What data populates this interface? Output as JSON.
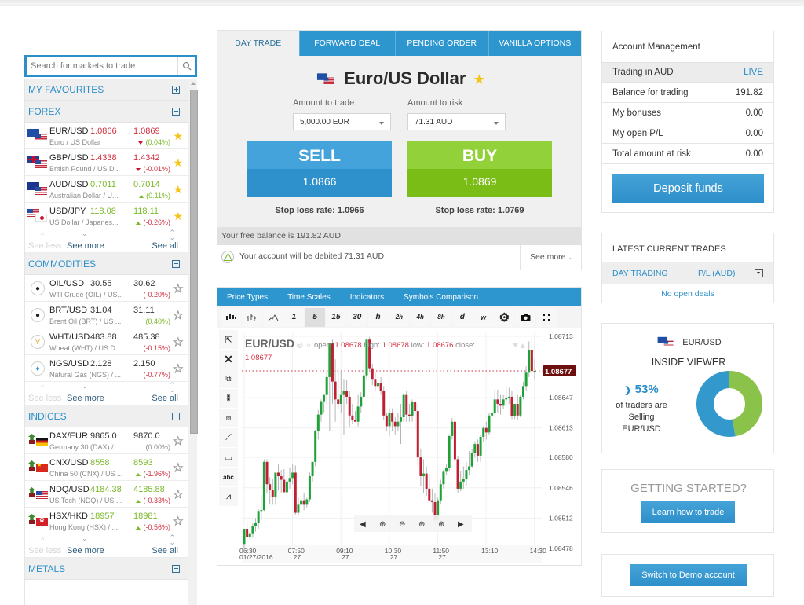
{
  "sidebar": {
    "search_placeholder": "Search for markets to trade",
    "categories": {
      "favourites": "MY FAVOURITES",
      "forex": "FOREX",
      "commodities": "COMMODITIES",
      "indices": "INDICES",
      "metals": "METALS"
    },
    "forex": [
      {
        "symbol": "EUR/USD",
        "bid": "1.0866",
        "ask": "1.0869",
        "desc": "Euro / US Dollar",
        "change": "(0.04%)",
        "dir": "down",
        "favourite": true
      },
      {
        "symbol": "GBP/USD",
        "bid": "1.4338",
        "ask": "1.4342",
        "desc": "British Pound / US D...",
        "change": "(-0.01%)",
        "dir": "down",
        "favourite": true
      },
      {
        "symbol": "AUD/USD",
        "bid": "0.7011",
        "ask": "0.7014",
        "desc": "Australian Dollar / U...",
        "change": "(0.11%)",
        "dir": "up",
        "favourite": true
      },
      {
        "symbol": "USD/JPY",
        "bid": "118.08",
        "ask": "118.11",
        "desc": "US Dollar / Japanes...",
        "change": "(-0.26%)",
        "dir": "up",
        "favourite": true
      }
    ],
    "commodities": [
      {
        "symbol": "OIL/USD",
        "bid": "30.55",
        "ask": "30.62",
        "desc": "WTI Crude (OIL) / US...",
        "change": "(-0.20%)",
        "dir": "none",
        "favourite": false
      },
      {
        "symbol": "BRT/USD",
        "bid": "31.04",
        "ask": "31.11",
        "desc": "Brent Oil (BRT) / US ...",
        "change": "(0.40%)",
        "dir": "none",
        "favourite": false
      },
      {
        "symbol": "WHT/USD",
        "bid": "483.88",
        "ask": "485.38",
        "desc": "Wheat (WHT) / US D...",
        "change": "(-0.15%)",
        "dir": "none",
        "favourite": false
      },
      {
        "symbol": "NGS/USD",
        "bid": "2.128",
        "ask": "2.150",
        "desc": "Natural Gas (NGS) / ...",
        "change": "(-0.77%)",
        "dir": "none",
        "favourite": false
      }
    ],
    "indices": [
      {
        "symbol": "DAX/EUR",
        "bid": "9865.0",
        "ask": "9870.0",
        "desc": "Germany 30 (DAX) / ...",
        "change": "(0.00%)",
        "dir": "none",
        "favourite": false
      },
      {
        "symbol": "CNX/USD",
        "bid": "8558",
        "ask": "8593",
        "desc": "China 50 (CNX) / US ...",
        "change": "(-1.96%)",
        "dir": "up",
        "favourite": false
      },
      {
        "symbol": "NDQ/USD",
        "bid": "4184.38",
        "ask": "4185.88",
        "desc": "US Tech (NDQ) / US ...",
        "change": "(-0.33%)",
        "dir": "up",
        "favourite": false
      },
      {
        "symbol": "HSX/HKD",
        "bid": "18957",
        "ask": "18981",
        "desc": "Hong Kong (HSX) / ...",
        "change": "(-0.56%)",
        "dir": "up",
        "favourite": false
      }
    ],
    "see_less": "See less",
    "see_more": "See more",
    "see_all": "See all",
    "colors": {
      "accent": "#2c8fc9",
      "red": "#d0303f",
      "green": "#7ab929",
      "star": "#f5c316"
    }
  },
  "trade": {
    "tabs": [
      "DAY TRADE",
      "FORWARD DEAL",
      "PENDING ORDER",
      "VANILLA OPTIONS"
    ],
    "active_tab": "DAY TRADE",
    "instrument": "Euro/US Dollar",
    "amount_trade_label": "Amount to trade",
    "amount_trade_value": "5,000.00 EUR",
    "amount_risk_label": "Amount to risk",
    "amount_risk_value": "71.31 AUD",
    "sell_label": "SELL",
    "sell_price": "1.0866",
    "buy_label": "BUY",
    "buy_price": "1.0869",
    "sell_stop_loss": "Stop loss rate: 1.0966",
    "buy_stop_loss": "Stop loss rate: 1.0769",
    "free_balance": "Your free balance is 191.82 AUD",
    "debit_notice": "Your account will be debited 71.31 AUD",
    "see_more": "See more"
  },
  "chart": {
    "menu": [
      "Price Types",
      "Time Scales",
      "Indicators",
      "Symbols Comparison"
    ],
    "timeframes": [
      "1",
      "5",
      "15",
      "30",
      "h",
      "2h",
      "4h",
      "8h",
      "d",
      "w"
    ],
    "selected_timeframe": "5",
    "symbol": "EUR/USD",
    "open_label": "open:",
    "open": "1.08678",
    "high_label": "high:",
    "high": "1.08678",
    "low_label": "low:",
    "low": "1.08676",
    "close_label": "close:",
    "close": "1.08677",
    "current_price": "1.08677"
  },
  "chart_data": {
    "type": "candlestick",
    "title": "EUR/USD",
    "interval": "5 min",
    "x_ticks": [
      {
        "label": "06:30",
        "sub": "01/27/2016",
        "index": 0
      },
      {
        "label": "07:50",
        "sub": "27",
        "index": 16
      },
      {
        "label": "09:10",
        "sub": "27",
        "index": 32
      },
      {
        "label": "10:30",
        "sub": "27",
        "index": 48
      },
      {
        "label": "11:50",
        "sub": "27",
        "index": 64
      },
      {
        "label": "13:10",
        "sub": "",
        "index": 80
      },
      {
        "label": "14:30",
        "sub": "",
        "index": 96
      }
    ],
    "y_ticks": [
      "1.08478",
      "1.08512",
      "1.08546",
      "1.08580",
      "1.08613",
      "1.08647",
      "1.08713"
    ],
    "ylim": [
      1.0847,
      1.08718
    ],
    "last_price": 1.08677,
    "colors": {
      "up": "#1fa13a",
      "down": "#c01f33",
      "wick": "#b5b5b5",
      "last": "#6e0f0f"
    },
    "candles": [
      [
        1.08483,
        1.085,
        1.08474,
        1.085
      ],
      [
        1.085,
        1.08508,
        1.08488,
        1.08491
      ],
      [
        1.08491,
        1.08497,
        1.08488,
        1.08495
      ],
      [
        1.08495,
        1.08506,
        1.0849,
        1.08503
      ],
      [
        1.08503,
        1.08512,
        1.08497,
        1.08507
      ],
      [
        1.08507,
        1.08522,
        1.085,
        1.0852
      ],
      [
        1.0852,
        1.08538,
        1.0851,
        1.08521
      ],
      [
        1.08521,
        1.08578,
        1.0852,
        1.08575
      ],
      [
        1.08575,
        1.08578,
        1.0854,
        1.0855
      ],
      [
        1.0855,
        1.08558,
        1.08528,
        1.08544
      ],
      [
        1.08544,
        1.08556,
        1.08527,
        1.08536
      ],
      [
        1.08536,
        1.0856,
        1.08527,
        1.08563
      ],
      [
        1.08563,
        1.08572,
        1.08543,
        1.08559
      ],
      [
        1.08559,
        1.08566,
        1.0854,
        1.08555
      ],
      [
        1.08555,
        1.08567,
        1.08545,
        1.08541
      ],
      [
        1.08541,
        1.0856,
        1.08535,
        1.08553
      ],
      [
        1.08553,
        1.08569,
        1.08545,
        1.08557
      ],
      [
        1.08557,
        1.08572,
        1.0855,
        1.08563
      ],
      [
        1.08563,
        1.08571,
        1.08516,
        1.08518
      ],
      [
        1.08518,
        1.08535,
        1.08516,
        1.08527
      ],
      [
        1.08527,
        1.08535,
        1.0852,
        1.08532
      ],
      [
        1.08532,
        1.0854,
        1.08521,
        1.08527
      ],
      [
        1.08527,
        1.08535,
        1.08524,
        1.08533
      ],
      [
        1.08533,
        1.08563,
        1.0853,
        1.08559
      ],
      [
        1.08559,
        1.08575,
        1.08553,
        1.08575
      ],
      [
        1.08575,
        1.08611,
        1.0857,
        1.0861
      ],
      [
        1.0861,
        1.08633,
        1.086,
        1.08628
      ],
      [
        1.08628,
        1.08645,
        1.0862,
        1.08643
      ],
      [
        1.08643,
        1.0865,
        1.0863,
        1.0865
      ],
      [
        1.0865,
        1.08677,
        1.0864,
        1.0867
      ],
      [
        1.0867,
        1.08708,
        1.0861,
        1.08708
      ],
      [
        1.08708,
        1.08712,
        1.0864,
        1.08665
      ],
      [
        1.08665,
        1.0869,
        1.0862,
        1.08645
      ],
      [
        1.08645,
        1.0868,
        1.08635,
        1.0864
      ],
      [
        1.0864,
        1.08678,
        1.0863,
        1.0865
      ],
      [
        1.0865,
        1.08668,
        1.08605,
        1.08655
      ],
      [
        1.08655,
        1.08667,
        1.0864,
        1.08648
      ],
      [
        1.08648,
        1.08655,
        1.08614,
        1.08627
      ],
      [
        1.08627,
        1.0864,
        1.08618,
        1.08622
      ],
      [
        1.08622,
        1.08632,
        1.0862,
        1.0862
      ],
      [
        1.0862,
        1.0865,
        1.08615,
        1.08637
      ],
      [
        1.08637,
        1.08653,
        1.0863,
        1.08648
      ],
      [
        1.08648,
        1.08687,
        1.08645,
        1.08672
      ],
      [
        1.08672,
        1.08712,
        1.08668,
        1.08712
      ],
      [
        1.08712,
        1.08715,
        1.08675,
        1.0868
      ],
      [
        1.0868,
        1.08685,
        1.08661,
        1.08668
      ],
      [
        1.08668,
        1.08675,
        1.08655,
        1.0866
      ],
      [
        1.0866,
        1.08668,
        1.08652,
        1.08663
      ],
      [
        1.08663,
        1.0867,
        1.0865,
        1.08655
      ],
      [
        1.08655,
        1.0866,
        1.08622,
        1.08627
      ],
      [
        1.08627,
        1.0863,
        1.0861,
        1.08615
      ],
      [
        1.08615,
        1.08635,
        1.08604,
        1.0863
      ],
      [
        1.0863,
        1.08635,
        1.0861,
        1.0862
      ],
      [
        1.0862,
        1.08625,
        1.08605,
        1.08615
      ],
      [
        1.08615,
        1.0863,
        1.0861,
        1.0862
      ],
      [
        1.0862,
        1.0864,
        1.08595,
        1.08625
      ],
      [
        1.08625,
        1.08652,
        1.0862,
        1.0865
      ],
      [
        1.0865,
        1.08655,
        1.0862,
        1.08628
      ],
      [
        1.08628,
        1.0864,
        1.0862,
        1.08626
      ],
      [
        1.08626,
        1.08645,
        1.0862,
        1.08642
      ],
      [
        1.08642,
        1.08645,
        1.08612,
        1.08632
      ],
      [
        1.08632,
        1.0864,
        1.0857,
        1.0858
      ],
      [
        1.0858,
        1.0859,
        1.08548,
        1.08559
      ],
      [
        1.08559,
        1.08578,
        1.0854,
        1.08562
      ],
      [
        1.08562,
        1.0857,
        1.08537,
        1.08545
      ],
      [
        1.08545,
        1.0856,
        1.0853,
        1.08532
      ],
      [
        1.08532,
        1.08545,
        1.08518,
        1.0853
      ],
      [
        1.0853,
        1.0854,
        1.08505,
        1.0851
      ],
      [
        1.0851,
        1.08535,
        1.08505,
        1.08532
      ],
      [
        1.08532,
        1.08555,
        1.08528,
        1.0855
      ],
      [
        1.0855,
        1.08566,
        1.08545,
        1.08564
      ],
      [
        1.08564,
        1.08572,
        1.0856,
        1.08568
      ],
      [
        1.08568,
        1.08606,
        1.08565,
        1.08604
      ],
      [
        1.08604,
        1.08624,
        1.086,
        1.0862
      ],
      [
        1.0862,
        1.08627,
        1.0857,
        1.08578
      ],
      [
        1.08578,
        1.08582,
        1.0854,
        1.08545
      ],
      [
        1.08545,
        1.08565,
        1.08542,
        1.08553
      ],
      [
        1.08553,
        1.0857,
        1.08545,
        1.08556
      ],
      [
        1.08556,
        1.08575,
        1.08548,
        1.08566
      ],
      [
        1.08566,
        1.08587,
        1.0856,
        1.0857
      ],
      [
        1.0857,
        1.0859,
        1.08568,
        1.08585
      ],
      [
        1.08585,
        1.08598,
        1.0858,
        1.08595
      ],
      [
        1.08595,
        1.086,
        1.08575,
        1.08582
      ],
      [
        1.08582,
        1.08605,
        1.08575,
        1.08603
      ],
      [
        1.08603,
        1.08615,
        1.08598,
        1.08613
      ],
      [
        1.08613,
        1.0862,
        1.086,
        1.08608
      ],
      [
        1.08608,
        1.0863,
        1.08605,
        1.08627
      ],
      [
        1.08627,
        1.0864,
        1.0862,
        1.0863
      ],
      [
        1.0863,
        1.08656,
        1.08625,
        1.08645
      ],
      [
        1.08645,
        1.08656,
        1.0863,
        1.0864
      ],
      [
        1.0864,
        1.0865,
        1.08628,
        1.08638
      ],
      [
        1.08638,
        1.0865,
        1.08634,
        1.08645
      ],
      [
        1.08645,
        1.0866,
        1.08638,
        1.08647
      ],
      [
        1.08647,
        1.08658,
        1.0864,
        1.08648
      ],
      [
        1.08648,
        1.08655,
        1.08623,
        1.08626
      ],
      [
        1.08626,
        1.0864,
        1.08623,
        1.0864
      ],
      [
        1.0864,
        1.0865,
        1.08622,
        1.08627
      ],
      [
        1.08627,
        1.0865,
        1.08625,
        1.08648
      ],
      [
        1.08648,
        1.08665,
        1.08645,
        1.0866
      ],
      [
        1.0866,
        1.08682,
        1.08655,
        1.08675
      ],
      [
        1.08675,
        1.0871,
        1.0867,
        1.087
      ],
      [
        1.087,
        1.08712,
        1.08673,
        1.08677
      ],
      [
        1.08677,
        1.0869,
        1.08668,
        1.08677
      ]
    ]
  },
  "account": {
    "title": "Account Management",
    "rows": [
      {
        "label": "Trading in AUD",
        "value": "LIVE"
      },
      {
        "label": "Balance for trading",
        "value": "191.82"
      },
      {
        "label": "My bonuses",
        "value": "0.00"
      },
      {
        "label": "My open P/L",
        "value": "0.00"
      },
      {
        "label": "Total amount at risk",
        "value": "0.00"
      }
    ],
    "deposit": "Deposit funds"
  },
  "latest": {
    "title": "LATEST CURRENT TRADES",
    "col1": "DAY TRADING",
    "col2": "P/L (AUD)",
    "empty": "No open deals"
  },
  "inside": {
    "pair": "EUR/USD",
    "title": "INSIDE VIEWER",
    "percent": "53%",
    "line1": "of traders are",
    "line2": "Selling",
    "line3": "EUR/USD",
    "selling_fraction": 0.53,
    "colors": {
      "selling": "#3399cc",
      "buying": "#8bc34a"
    }
  },
  "getting_started": {
    "title": "GETTING STARTED?",
    "button": "Learn how to trade"
  },
  "demo": {
    "button": "Switch to Demo account"
  }
}
